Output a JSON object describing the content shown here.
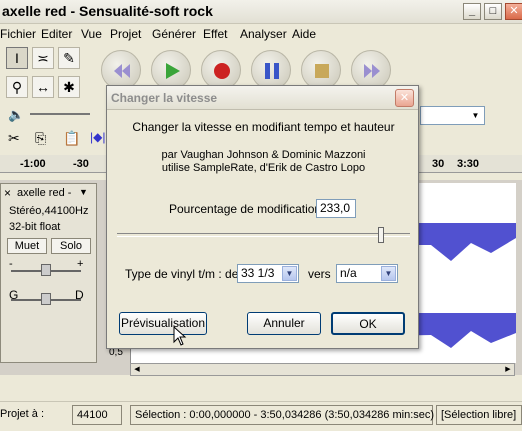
{
  "window": {
    "title": "axelle red - Sensualité-soft rock"
  },
  "menu": [
    "Fichier",
    "Editer",
    "Vue",
    "Projet",
    "Générer",
    "Effet",
    "Analyser",
    "Aide"
  ],
  "ruler": {
    "ticks": [
      "-1:00",
      "-30",
      "30",
      "3:30"
    ]
  },
  "track": {
    "name": "axelle red -",
    "format": "Stéréo,44100Hz",
    "bits": "32-bit float",
    "mute_label": "Muet",
    "solo_label": "Solo",
    "gain_minus": "-",
    "gain_plus": "+",
    "pan_left": "G",
    "pan_right": "D",
    "close_glyph": "×",
    "menu_glyph": "▼",
    "wave_label": "0,5"
  },
  "dialog": {
    "title": "Changer la vitesse",
    "close_glyph": "✕",
    "heading": "Changer la vitesse en modifiant tempo et hauteur",
    "credit1": "par Vaughan Johnson & Dominic Mazzoni",
    "credit2": "utilise SampleRate, d'Erik de Castro Lopo",
    "percent_label": "Pourcentage de modification :",
    "percent_value": "233,0",
    "slider_value": 0.9,
    "vinyl_label": "Type de vinyl t/m : de",
    "vinyl_from": "33 1/3",
    "vinyl_to_label": "vers",
    "vinyl_to": "n/a",
    "preview_label": "Prévisualisation",
    "cancel_label": "Annuler",
    "ok_label": "OK"
  },
  "status": {
    "project_label": "Projet à :",
    "rate": "44100",
    "selection": "Sélection : 0:00,000000 - 3:50,034286 (3:50,034286 min:sec)",
    "mode": "[Sélection libre]"
  },
  "colors": {
    "wave": "#3232C8",
    "accent": "#003C74"
  }
}
